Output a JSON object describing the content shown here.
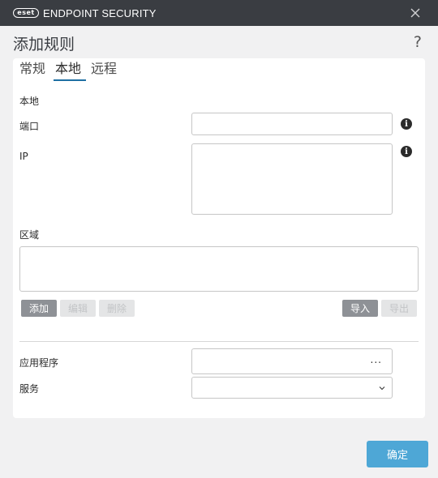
{
  "titlebar": {
    "logo_text": "eset",
    "product_name": "ENDPOINT SECURITY",
    "close_icon": "close-icon"
  },
  "header": {
    "title": "添加规则",
    "help_label": "?"
  },
  "tabs": [
    {
      "label": "常规",
      "active": false
    },
    {
      "label": "本地",
      "active": true
    },
    {
      "label": "远程",
      "active": false
    }
  ],
  "local": {
    "section_title": "本地",
    "port_label": "端口",
    "port_value": "",
    "ip_label": "IP",
    "ip_value": "",
    "info_icon": "info-icon"
  },
  "zone": {
    "label": "区域",
    "value": "",
    "buttons": {
      "add": "添加",
      "edit": "编辑",
      "delete": "删除",
      "import": "导入",
      "export": "导出"
    }
  },
  "app": {
    "application_label": "应用程序",
    "application_value": "",
    "browse_label": "...",
    "service_label": "服务",
    "service_value": ""
  },
  "footer": {
    "ok_label": "确定"
  },
  "colors": {
    "titlebar": "#3a3d42",
    "accent": "#1e6fa3",
    "ok_button": "#4ea7d6"
  }
}
